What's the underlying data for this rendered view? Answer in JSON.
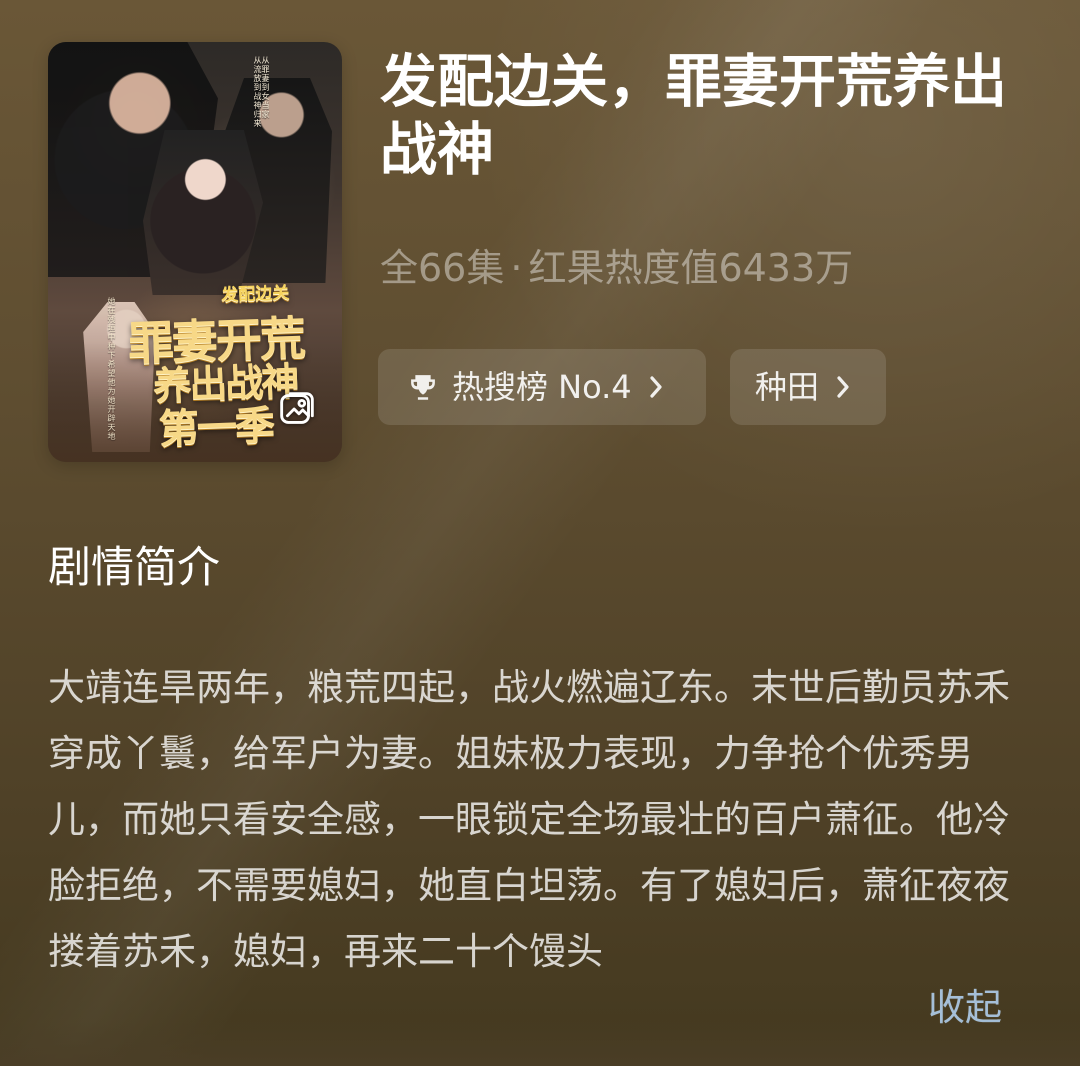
{
  "show": {
    "title": "发配边关，罪妻开荒养出战神",
    "episodes": "全66集",
    "heat_text": "红果热度值6433万"
  },
  "cover": {
    "logo_small": "发配边关",
    "logo_line1": "罪妻开荒",
    "logo_line2": "养出战神",
    "logo_line3": "第一季",
    "side_text": "她在残垣中种下希望他为她开辟天地",
    "top_text_lines": [
      "从罪妻到女当家",
      "从流放到战神归来"
    ],
    "gallery_icon": "gallery-icon"
  },
  "chips": [
    {
      "label": "热搜榜 No.4",
      "icon": "trophy-icon"
    },
    {
      "label": "种田",
      "icon": "chevron-right-icon"
    }
  ],
  "intro": {
    "title": "剧情简介",
    "synopsis": "大靖连旱两年，粮荒四起，战火燃遍辽东。末世后勤员苏禾穿成丫鬟，给军户为妻。姐妹极力表现，力争抢个优秀男儿，而她只看安全感，一眼锁定全场最壮的百户萧征。他冷脸拒绝，不需要媳妇，她直白坦荡。有了媳妇后，萧征夜夜搂着苏禾，媳妇，再来二十个馒头",
    "collapse_label": "收起"
  },
  "colors": {
    "background_top": "#6a5737",
    "background_bottom": "#44391f",
    "link": "#a5bfd8",
    "chip_bg": "rgba(255,255,255,0.12)"
  }
}
